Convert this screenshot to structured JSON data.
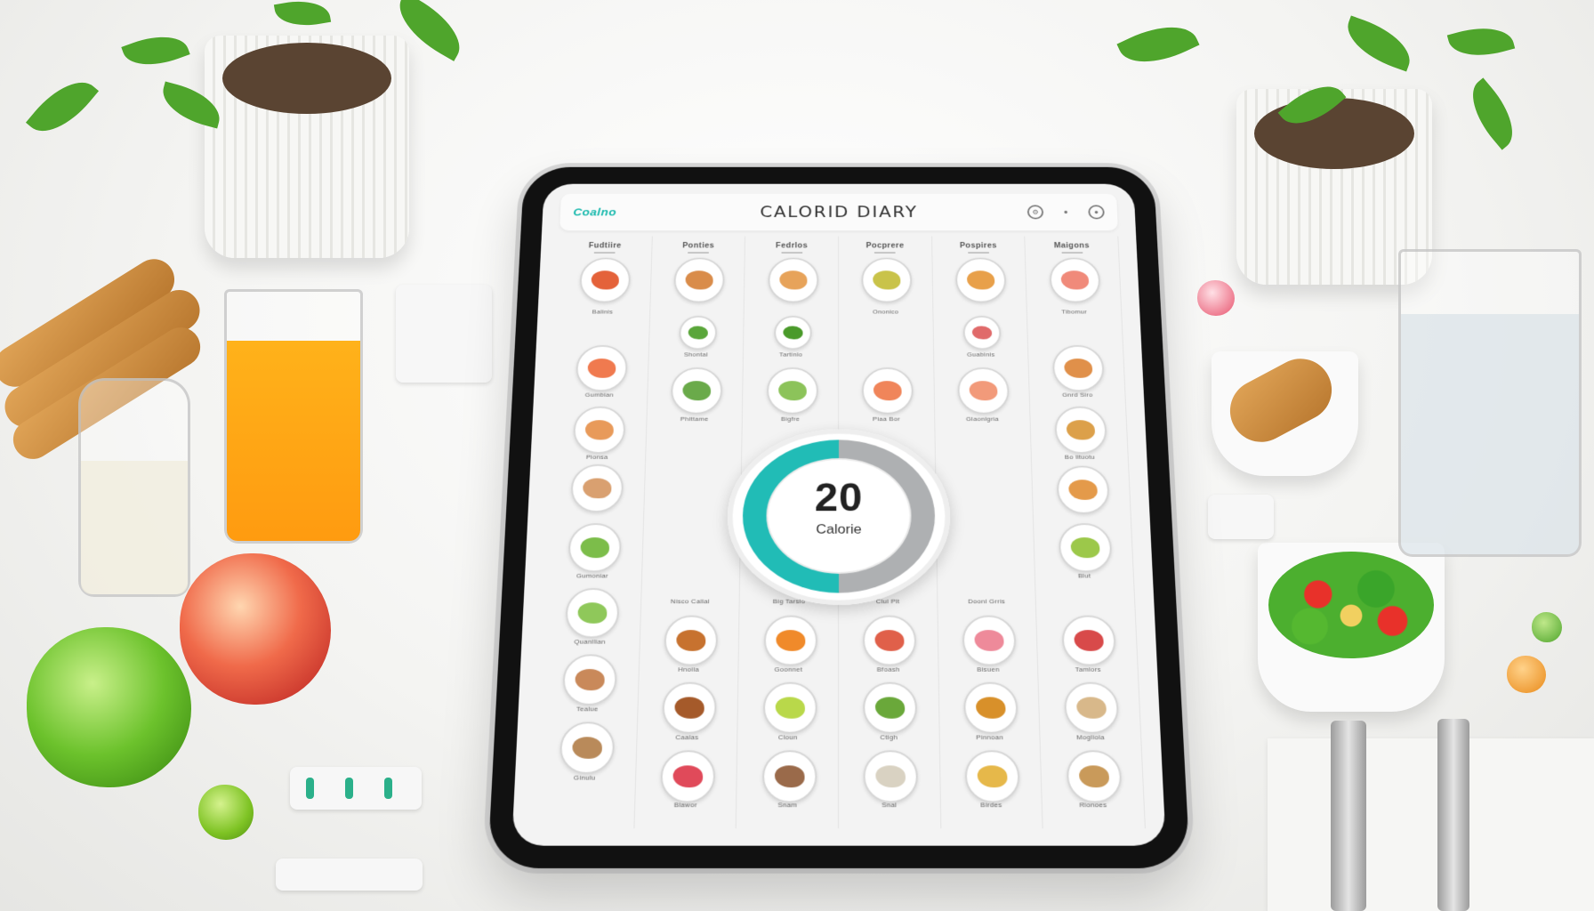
{
  "app": {
    "logo_text": "Coalno",
    "title": "CALORID DIARY",
    "top_icons": [
      "settings-icon",
      "menu-icon",
      "profile-icon"
    ]
  },
  "columns": [
    {
      "header": "Fudtiire",
      "labels": [
        "Balinis",
        "Gumbian",
        "Pionsa",
        "Gumoniar",
        "Quanilian",
        "Tealue",
        "Ginulu"
      ]
    },
    {
      "header": "Ponties",
      "labels": [
        "Shontal",
        "Phittame",
        "Nisco Callal",
        "Hnoiia",
        "Caalas",
        "Blawor"
      ]
    },
    {
      "header": "Fedrlos",
      "labels": [
        "Tartinlo",
        "Bigfre",
        "Big Tarsio",
        "Goonnet",
        "Cloun",
        "Snam"
      ]
    },
    {
      "header": "Pocprere",
      "labels": [
        "Ononico",
        "Piaa Bor",
        "Clul Plt",
        "Bfoash",
        "Ctigh",
        "Snal"
      ]
    },
    {
      "header": "Pospires",
      "labels": [
        "Guabinis",
        "Glaonlgria",
        "Doonl Grris",
        "Bisuen",
        "Pinnoan",
        "Birdes"
      ]
    },
    {
      "header": "Maigons",
      "labels": [
        "Tibomur",
        "Gnrd Siro",
        "Bo lituotu",
        "Blut",
        "Tamiors",
        "Mogliola",
        "Rionoes"
      ]
    }
  ],
  "calorie_dial": {
    "value": "20",
    "unit": "Calorie"
  }
}
